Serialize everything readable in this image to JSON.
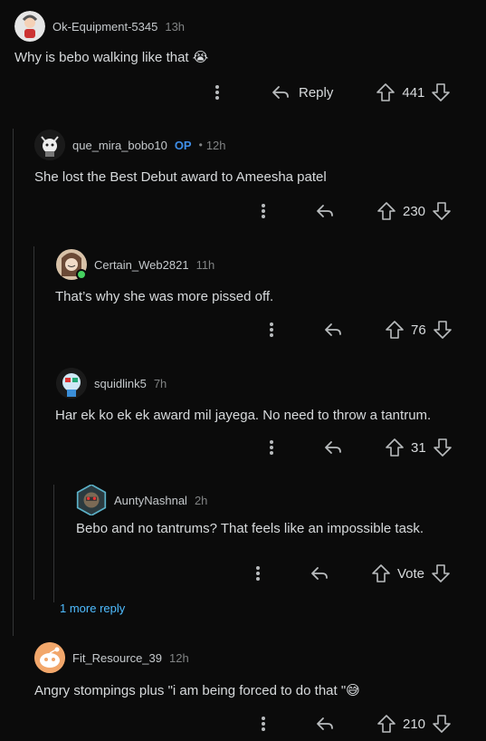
{
  "comments": [
    {
      "username": "Ok-Equipment-5345",
      "time": "13h",
      "text": "Why is bebo walking like that 😭",
      "votes": "441",
      "reply_label": "Reply"
    },
    {
      "username": "que_mira_bobo10",
      "op_badge": "OP",
      "separator": "•",
      "time": "12h",
      "text": "She lost the Best Debut award to Ameesha patel",
      "votes": "230"
    },
    {
      "username": "Certain_Web2821",
      "time": "11h",
      "text": "That’s why she was more pissed off.",
      "votes": "76"
    },
    {
      "username": "squidlink5",
      "time": "7h",
      "text": "Har ek ko ek ek award mil jayega. No need to throw a tantrum.",
      "votes": "31"
    },
    {
      "username": "AuntyNashnal",
      "time": "2h",
      "text": "Bebo and no tantrums? That feels like an impossible task.",
      "votes": "Vote"
    },
    {
      "username": "Fit_Resource_39",
      "time": "12h",
      "text": "Angry stompings plus \"i am being forced to do that \"😅",
      "votes": "210"
    }
  ],
  "more_replies_label": "1 more reply",
  "colors": {
    "background": "#0b0b0b",
    "text": "#d7dadc",
    "meta": "#818384",
    "op": "#3f8ee8",
    "link": "#4fbcff",
    "online": "#46d160"
  },
  "icons": [
    "more-vertical-icon",
    "reply-arrow-icon",
    "upvote-icon",
    "downvote-icon"
  ]
}
